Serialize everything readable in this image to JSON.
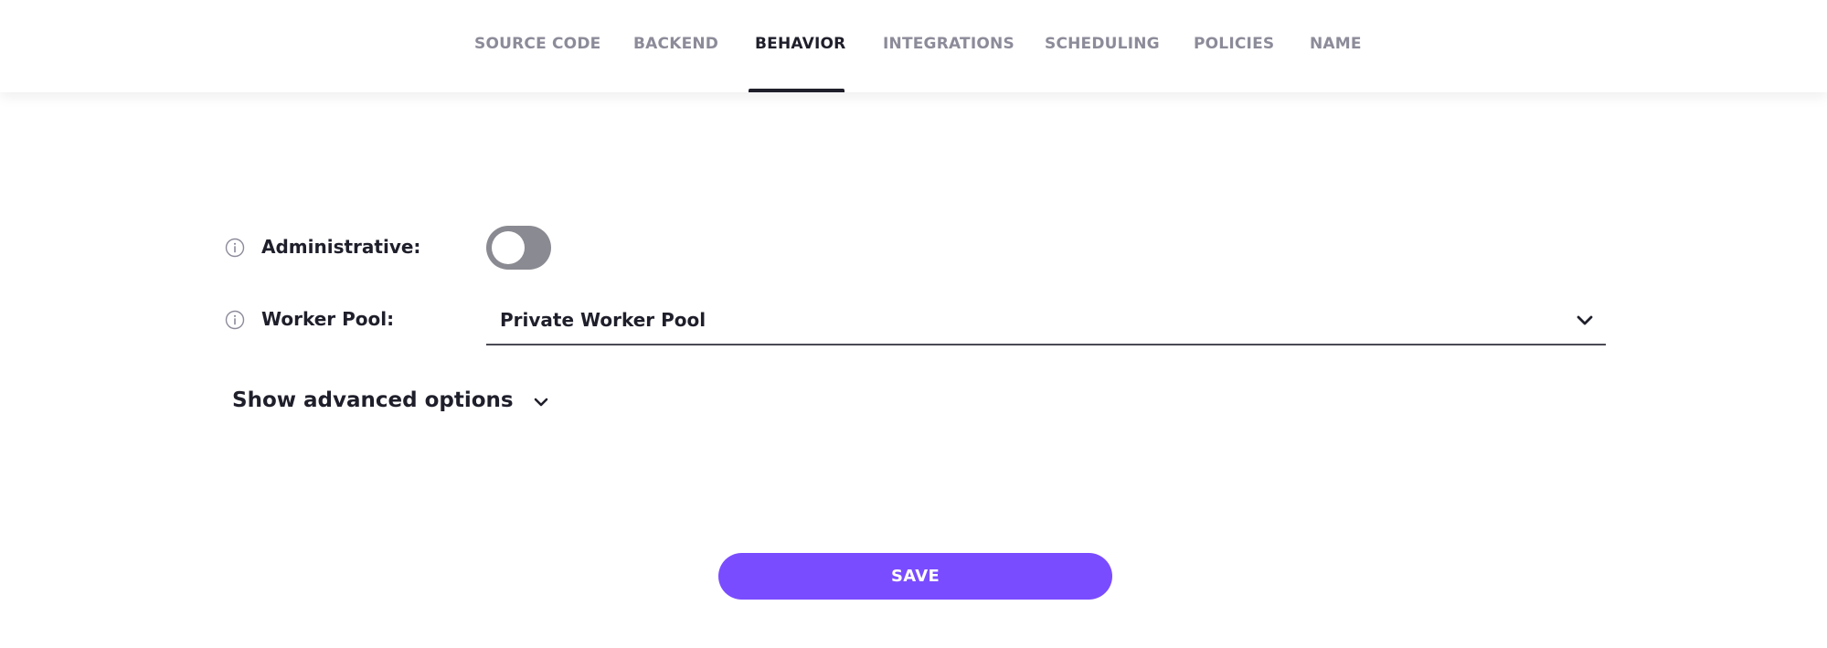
{
  "tabs": [
    {
      "label": "SOURCE CODE",
      "active": false
    },
    {
      "label": "BACKEND",
      "active": false
    },
    {
      "label": "BEHAVIOR",
      "active": true
    },
    {
      "label": "INTEGRATIONS",
      "active": false
    },
    {
      "label": "SCHEDULING",
      "active": false
    },
    {
      "label": "POLICIES",
      "active": false
    },
    {
      "label": "NAME",
      "active": false
    }
  ],
  "form": {
    "administrative": {
      "label": "Administrative:",
      "enabled": false,
      "info_icon": "info-icon"
    },
    "worker_pool": {
      "label": "Worker Pool:",
      "selected": "Private Worker Pool",
      "info_icon": "info-icon"
    }
  },
  "advanced": {
    "label": "Show advanced options",
    "icon": "chevron-down-icon"
  },
  "save": {
    "label": "SAVE"
  },
  "colors": {
    "accent": "#7a4cff",
    "toggle_off": "#8a8a92",
    "tab_inactive": "#8c8b99",
    "text": "#1f1f2b"
  }
}
